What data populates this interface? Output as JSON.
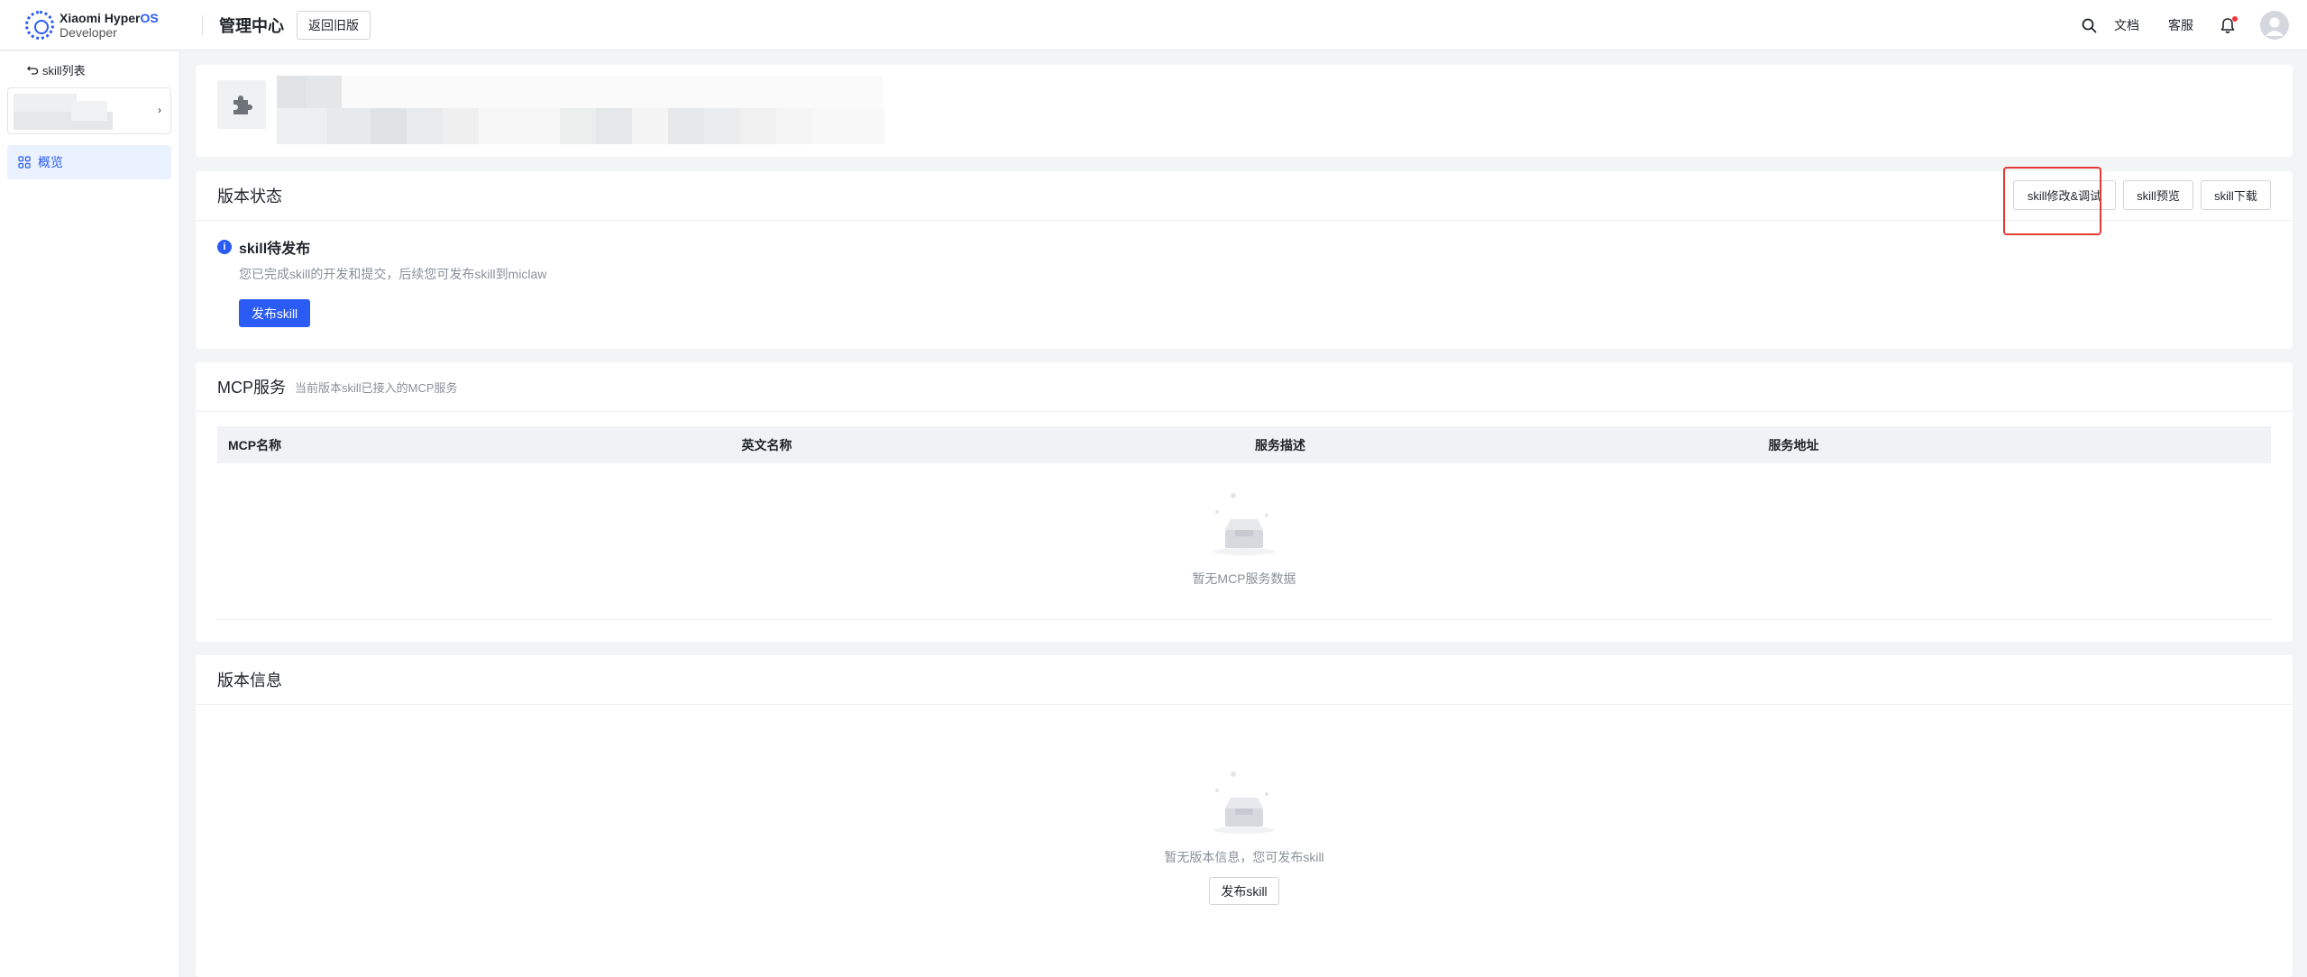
{
  "header": {
    "logo_line1_brand": "Xiaomi Hyper",
    "logo_line1_os": "OS",
    "logo_line2": "Developer",
    "title": "管理中心",
    "old_version_label": "返回旧版",
    "docs_label": "文档",
    "support_label": "客服"
  },
  "sidebar": {
    "back_label": "skill列表",
    "nav_overview_label": "概览"
  },
  "status_card": {
    "title": "版本状态",
    "btn_edit": "skill修改&调试",
    "btn_preview": "skill预览",
    "btn_download": "skill下载",
    "status_title": "skill待发布",
    "status_desc": "您已完成skill的开发和提交，后续您可发布skill到miclaw",
    "publish_label": "发布skill"
  },
  "mcp_card": {
    "title": "MCP服务",
    "subtitle": "当前版本skill已接入的MCP服务",
    "columns": [
      "MCP名称",
      "英文名称",
      "服务描述",
      "服务地址"
    ],
    "empty_text": "暂无MCP服务数据"
  },
  "info_card": {
    "title": "版本信息",
    "empty_text": "暂无版本信息，您可发布skill",
    "publish_label": "发布skill"
  },
  "colors": {
    "accent": "#2a5bf5",
    "highlight": "#e53935"
  }
}
